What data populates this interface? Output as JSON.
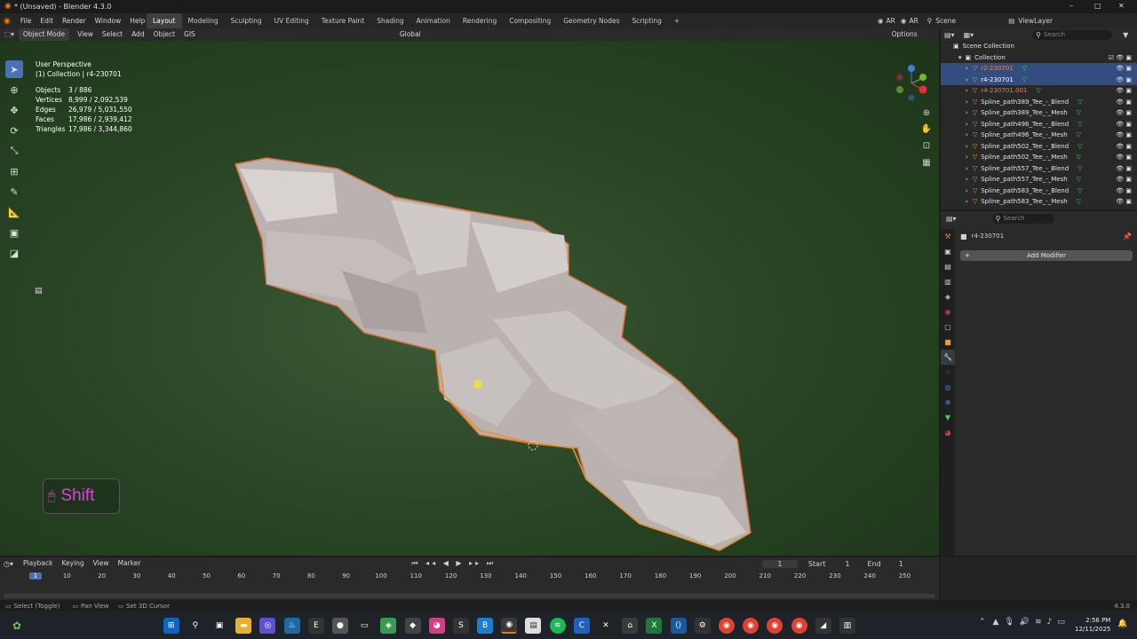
{
  "titlebar": {
    "title": "* (Unsaved) - Blender 4.3.0",
    "win_min": "–",
    "win_max": "□",
    "win_close": "✕"
  },
  "menu": [
    "File",
    "Edit",
    "Render",
    "Window",
    "Help"
  ],
  "workspaces": [
    "Layout",
    "Modeling",
    "Sculpting",
    "UV Editing",
    "Texture Paint",
    "Shading",
    "Animation",
    "Rendering",
    "Compositing",
    "Geometry Nodes",
    "Scripting"
  ],
  "workspace_add": "+",
  "top_right": {
    "ar1": "AR",
    "ar2": "AR",
    "scene": "Scene",
    "viewlayer": "ViewLayer"
  },
  "viewport_header": {
    "mode": "Object Mode",
    "menus": [
      "View",
      "Select",
      "Add",
      "Object",
      "GIS"
    ],
    "orientation": "Global",
    "options": "Options"
  },
  "overlay": {
    "perspective": "User Perspective",
    "collection": "(1) Collection | r4-230701",
    "stats": [
      {
        "label": "Objects",
        "value": "3 / 886"
      },
      {
        "label": "Vertices",
        "value": "8,999 / 2,092,539"
      },
      {
        "label": "Edges",
        "value": "26,979 / 5,031,550"
      },
      {
        "label": "Faces",
        "value": "17,986 / 2,939,412"
      },
      {
        "label": "Triangles",
        "value": "17,986 / 3,344,860"
      }
    ],
    "key_hint": "Shift"
  },
  "outliner": {
    "search_placeholder": "Search",
    "scene_collection": "Scene Collection",
    "collection": "Collection",
    "items": [
      {
        "name": "r2-230701",
        "color": "#e0844a",
        "selected": true
      },
      {
        "name": "r4-230701",
        "color": "#ffffff",
        "selected": true
      },
      {
        "name": "r4-230701.001",
        "color": "#e0844a",
        "selected": false
      },
      {
        "name": "Spline_path389_Tee_-_Blend",
        "color": "#e3e3e3",
        "selected": false
      },
      {
        "name": "Spline_path389_Tee_-_Mesh",
        "color": "#e3e3e3",
        "selected": false
      },
      {
        "name": "Spline_path496_Tee_-_Blend",
        "color": "#e3e3e3",
        "selected": false
      },
      {
        "name": "Spline_path496_Tee_-_Mesh",
        "color": "#e3e3e3",
        "selected": false
      },
      {
        "name": "Spline_path502_Tee_-_Blend",
        "color": "#e3e3e3",
        "selected": false
      },
      {
        "name": "Spline_path502_Tee_-_Mesh",
        "color": "#e3e3e3",
        "selected": false
      },
      {
        "name": "Spline_path557_Tee_-_Blend",
        "color": "#e3e3e3",
        "selected": false
      },
      {
        "name": "Spline_path557_Tee_-_Mesh",
        "color": "#e3e3e3",
        "selected": false
      },
      {
        "name": "Spline_path583_Tee_-_Blend",
        "color": "#e3e3e3",
        "selected": false
      },
      {
        "name": "Spline_path583_Tee_-_Mesh",
        "color": "#e3e3e3",
        "selected": false
      }
    ]
  },
  "properties": {
    "search_placeholder": "Search",
    "object_name": "r4-230701",
    "add_modifier": "Add Modifier"
  },
  "timeline": {
    "menus": [
      "Playback",
      "Keying",
      "View",
      "Marker"
    ],
    "current_frame": "1",
    "start_label": "Start",
    "start": "1",
    "end_label": "End",
    "end": "1",
    "ticks": [
      "1",
      "10",
      "20",
      "30",
      "40",
      "50",
      "60",
      "70",
      "80",
      "90",
      "100",
      "110",
      "120",
      "130",
      "140",
      "150",
      "160",
      "170",
      "180",
      "190",
      "200",
      "210",
      "220",
      "230",
      "240",
      "250"
    ]
  },
  "status": {
    "select": "Select (Toggle)",
    "pan": "Pan View",
    "cursor": "Set 3D Cursor",
    "version": "4.3.0"
  },
  "taskbar": {
    "time": "2:56 PM",
    "date": "12/11/2025"
  }
}
